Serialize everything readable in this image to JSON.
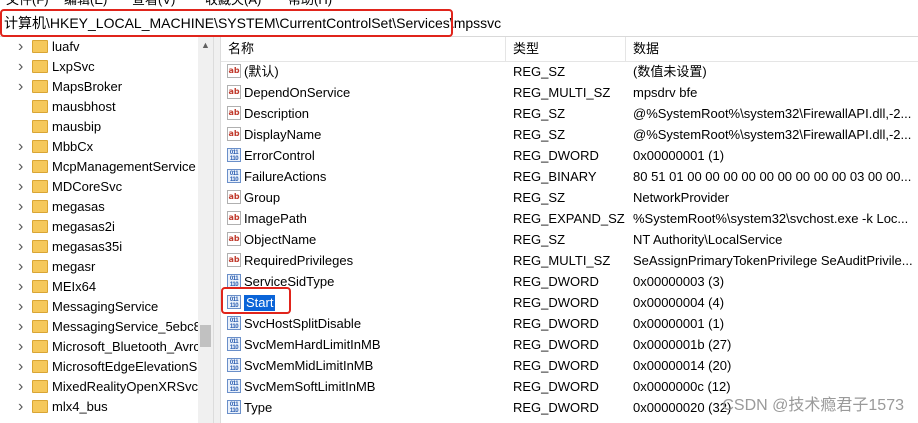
{
  "menu": [
    "文件(F)",
    "编辑(E)",
    "查看(V)",
    "收藏夹(A)",
    "帮助(H)"
  ],
  "address_path": "计算机\\HKEY_LOCAL_MACHINE\\SYSTEM\\CurrentControlSet\\Services\\mpssvc",
  "tree": {
    "items": [
      {
        "label": "luafv",
        "expander": true
      },
      {
        "label": "LxpSvc",
        "expander": true
      },
      {
        "label": "MapsBroker",
        "expander": true
      },
      {
        "label": "mausbhost",
        "expander": false
      },
      {
        "label": "mausbip",
        "expander": false
      },
      {
        "label": "MbbCx",
        "expander": true
      },
      {
        "label": "McpManagementService",
        "expander": true
      },
      {
        "label": "MDCoreSvc",
        "expander": true
      },
      {
        "label": "megasas",
        "expander": true
      },
      {
        "label": "megasas2i",
        "expander": true
      },
      {
        "label": "megasas35i",
        "expander": true
      },
      {
        "label": "megasr",
        "expander": true
      },
      {
        "label": "MEIx64",
        "expander": true
      },
      {
        "label": "MessagingService",
        "expander": true
      },
      {
        "label": "MessagingService_5ebc8",
        "expander": true
      },
      {
        "label": "Microsoft_Bluetooth_Avrc",
        "expander": true
      },
      {
        "label": "MicrosoftEdgeElevationS",
        "expander": true
      },
      {
        "label": "MixedRealityOpenXRSvc",
        "expander": true
      },
      {
        "label": "mlx4_bus",
        "expander": true
      }
    ]
  },
  "list": {
    "headers": {
      "name": "名称",
      "type": "类型",
      "data": "数据"
    },
    "rows": [
      {
        "icon": "string-value-icon",
        "name": "(默认)",
        "type": "REG_SZ",
        "data": "(数值未设置)"
      },
      {
        "icon": "string-value-icon",
        "name": "DependOnService",
        "type": "REG_MULTI_SZ",
        "data": "mpsdrv bfe"
      },
      {
        "icon": "string-value-icon",
        "name": "Description",
        "type": "REG_SZ",
        "data": "@%SystemRoot%\\system32\\FirewallAPI.dll,-2..."
      },
      {
        "icon": "string-value-icon",
        "name": "DisplayName",
        "type": "REG_SZ",
        "data": "@%SystemRoot%\\system32\\FirewallAPI.dll,-2..."
      },
      {
        "icon": "binary-value-icon",
        "name": "ErrorControl",
        "type": "REG_DWORD",
        "data": "0x00000001 (1)"
      },
      {
        "icon": "binary-value-icon",
        "name": "FailureActions",
        "type": "REG_BINARY",
        "data": "80 51 01 00 00 00 00 00 00 00 00 00 03 00 00..."
      },
      {
        "icon": "string-value-icon",
        "name": "Group",
        "type": "REG_SZ",
        "data": "NetworkProvider"
      },
      {
        "icon": "string-value-icon",
        "name": "ImagePath",
        "type": "REG_EXPAND_SZ",
        "data": "%SystemRoot%\\system32\\svchost.exe -k Loc..."
      },
      {
        "icon": "string-value-icon",
        "name": "ObjectName",
        "type": "REG_SZ",
        "data": "NT Authority\\LocalService"
      },
      {
        "icon": "string-value-icon",
        "name": "RequiredPrivileges",
        "type": "REG_MULTI_SZ",
        "data": "SeAssignPrimaryTokenPrivilege SeAuditPrivile..."
      },
      {
        "icon": "binary-value-icon",
        "name": "ServiceSidType",
        "type": "REG_DWORD",
        "data": "0x00000003 (3)"
      },
      {
        "icon": "binary-value-icon",
        "name": "Start",
        "type": "REG_DWORD",
        "data": "0x00000004 (4)",
        "selected": true
      },
      {
        "icon": "binary-value-icon",
        "name": "SvcHostSplitDisable",
        "type": "REG_DWORD",
        "data": "0x00000001 (1)"
      },
      {
        "icon": "binary-value-icon",
        "name": "SvcMemHardLimitInMB",
        "type": "REG_DWORD",
        "data": "0x0000001b (27)"
      },
      {
        "icon": "binary-value-icon",
        "name": "SvcMemMidLimitInMB",
        "type": "REG_DWORD",
        "data": "0x00000014 (20)"
      },
      {
        "icon": "binary-value-icon",
        "name": "SvcMemSoftLimitInMB",
        "type": "REG_DWORD",
        "data": "0x0000000c (12)"
      },
      {
        "icon": "binary-value-icon",
        "name": "Type",
        "type": "REG_DWORD",
        "data": "0x00000020 (32)"
      }
    ]
  },
  "watermark": "CSDN @技术瘾君子1573",
  "colors": {
    "annotation_red": "#e0241b",
    "selection_blue": "#0a64d8",
    "folder_yellow": "#f5c85b"
  }
}
